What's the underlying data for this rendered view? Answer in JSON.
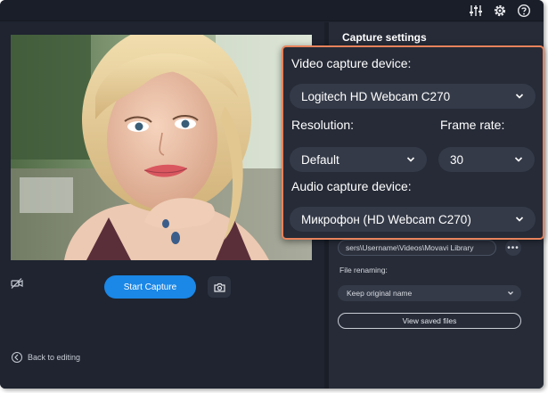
{
  "colors": {
    "accent": "#1b87e6",
    "callout_border": "#e8835c",
    "panel_bg": "#262b37",
    "app_bg": "#1f2430"
  },
  "icons": {
    "topbar": [
      "sliders-icon",
      "gear-icon",
      "help-icon"
    ],
    "preview_controls": [
      "hide-camera-icon",
      "camera-icon"
    ],
    "back": "arrow-left-icon"
  },
  "preview": {
    "start_label": "Start Capture"
  },
  "back_link": {
    "label": "Back to editing"
  },
  "settings": {
    "title": "Capture settings",
    "save_path": "sers\\Username\\Videos\\Movavi Library",
    "browse_label": "•••",
    "file_renaming_label": "File renaming:",
    "file_renaming_value": "Keep original name",
    "view_saved_label": "View saved files"
  },
  "callout": {
    "video_device_label": "Video capture device:",
    "video_device_value": "Logitech HD Webcam C270",
    "resolution_label": "Resolution:",
    "resolution_value": "Default",
    "frame_rate_label": "Frame rate:",
    "frame_rate_value": "30",
    "audio_device_label": "Audio capture device:",
    "audio_device_value": "Микрофон (HD Webcam C270)"
  }
}
